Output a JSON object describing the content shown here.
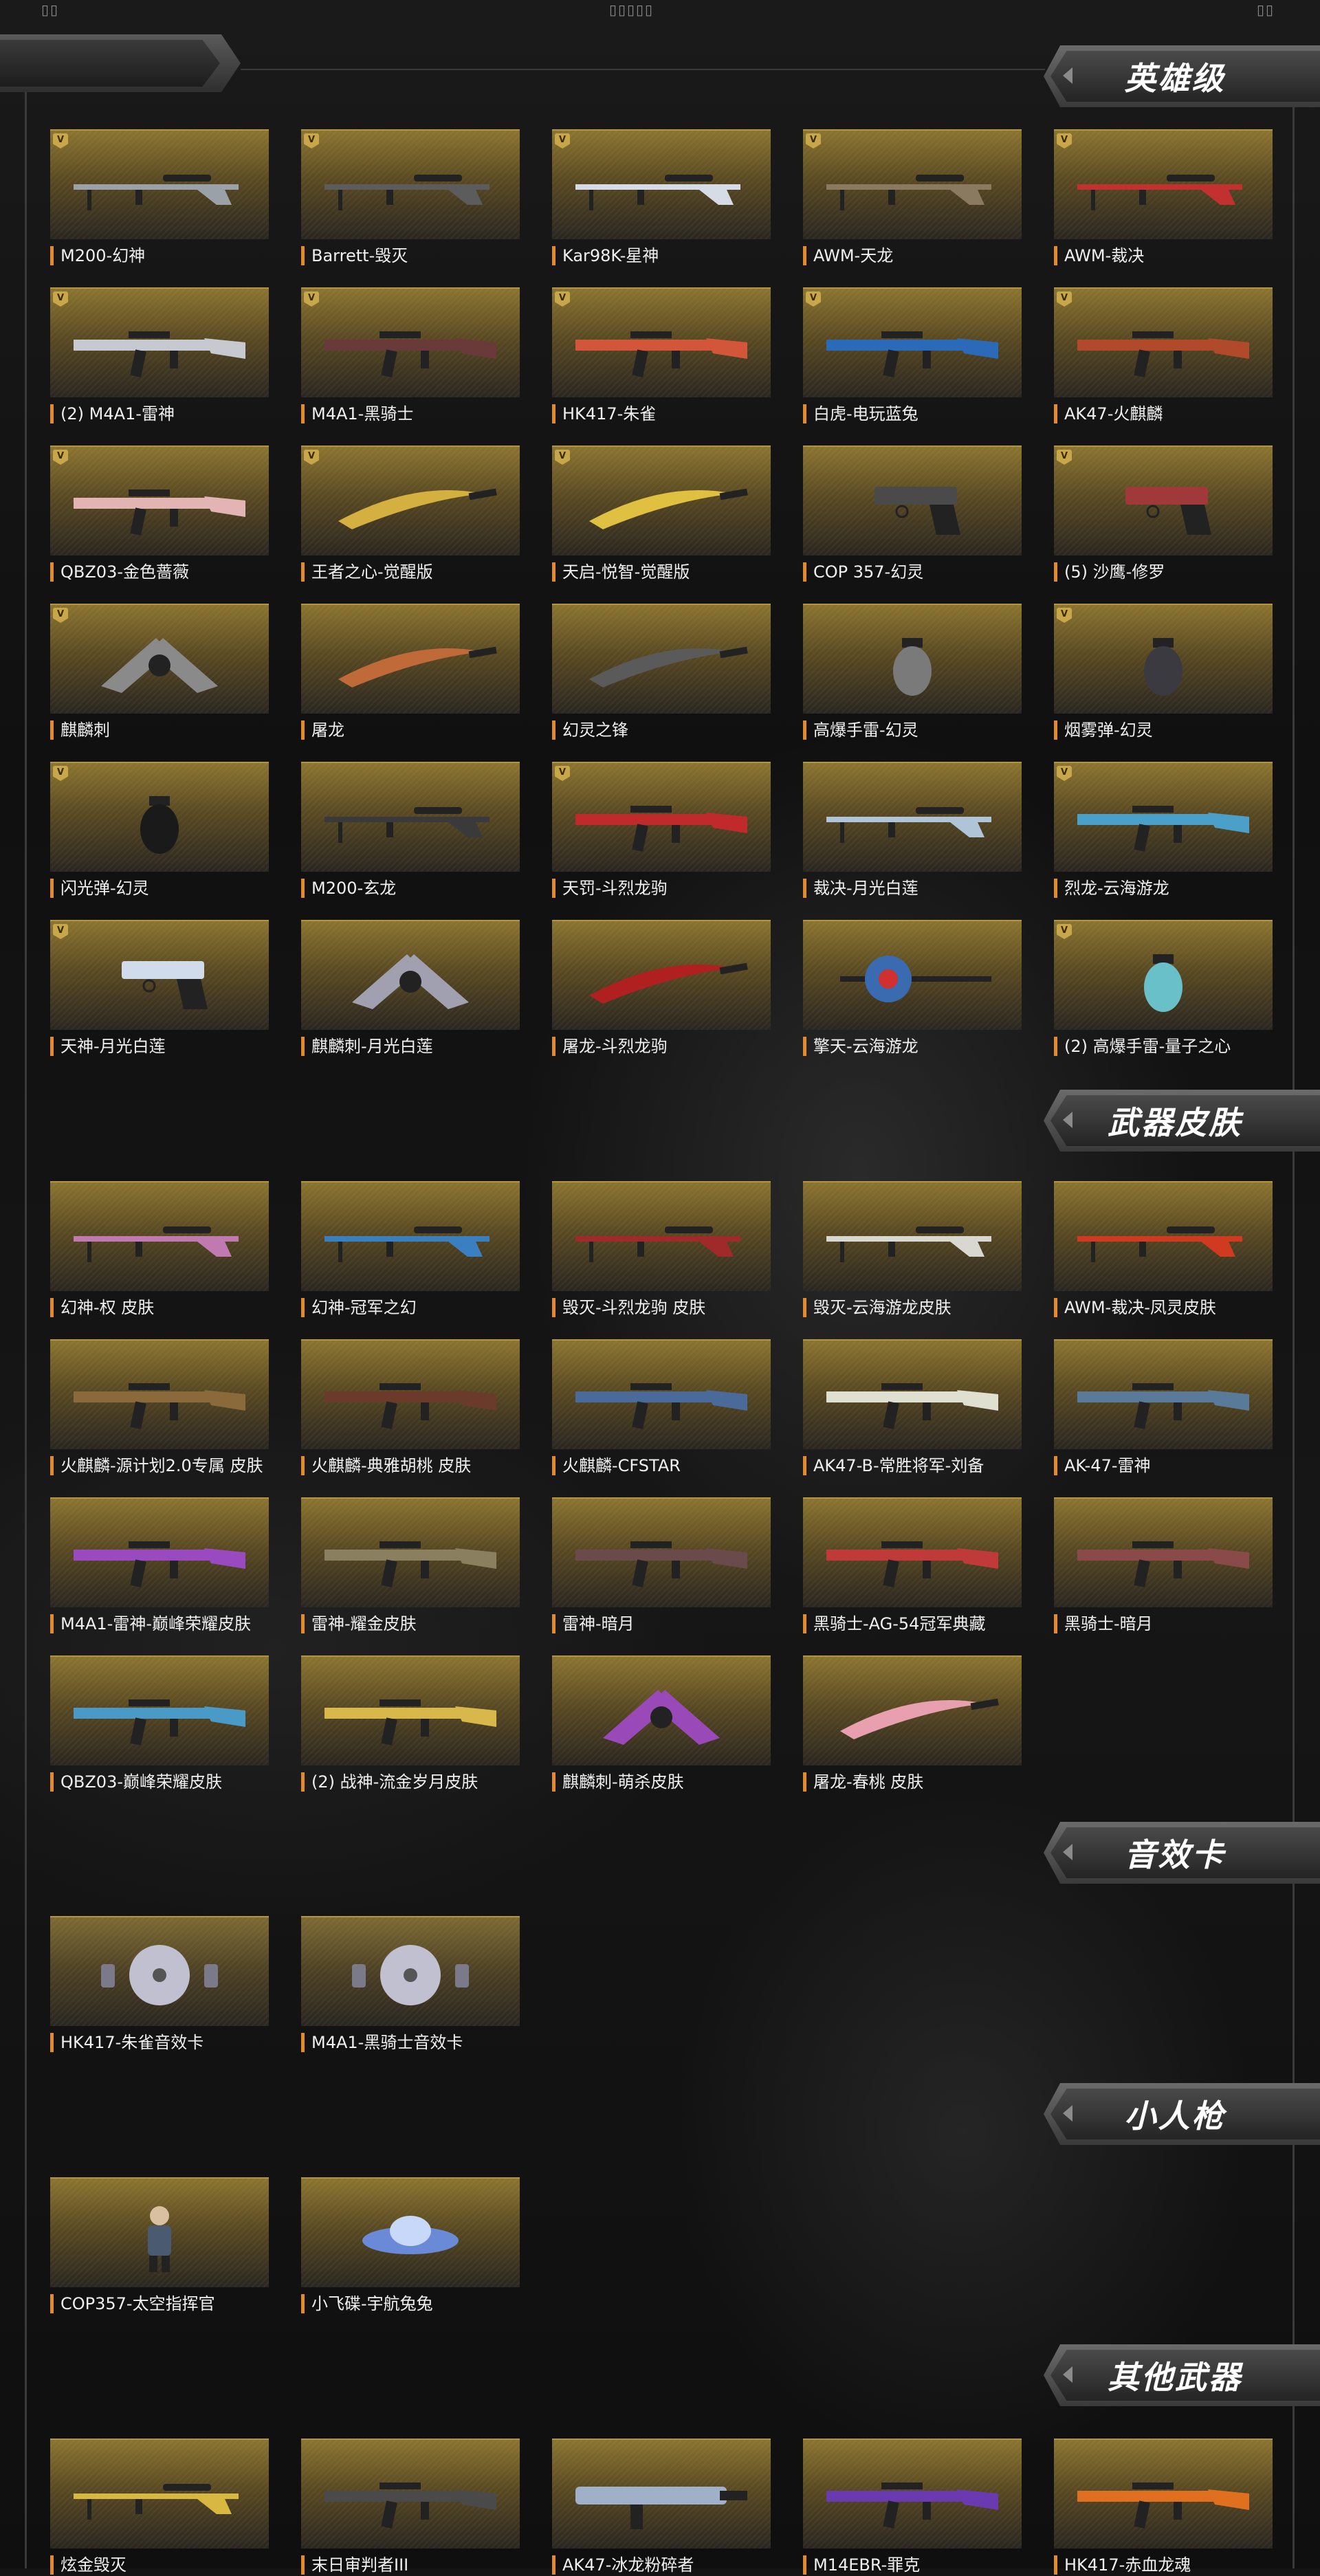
{
  "top_marks": {
    "left": "▯▯",
    "center": "▯▯▯▯▯",
    "right": "▯▯"
  },
  "sections": [
    {
      "title": "英雄级",
      "items": [
        {
          "label": "M200-幻神",
          "icon": "sniper-rifle-icon",
          "color": "#9aa2a8",
          "badge": true
        },
        {
          "label": "Barrett-毁灭",
          "icon": "sniper-rifle-icon",
          "color": "#5c5c5c",
          "badge": true
        },
        {
          "label": "Kar98K-星神",
          "icon": "sniper-rifle-icon",
          "color": "#d6dce6",
          "badge": true
        },
        {
          "label": "AWM-天龙",
          "icon": "sniper-rifle-icon",
          "color": "#8a7a60",
          "badge": true
        },
        {
          "label": "AWM-裁决",
          "icon": "sniper-rifle-icon",
          "color": "#c23030",
          "badge": true
        },
        {
          "label": "(2) M4A1-雷神",
          "icon": "assault-rifle-icon",
          "color": "#c6c9d0",
          "badge": true
        },
        {
          "label": "M4A1-黑骑士",
          "icon": "assault-rifle-icon",
          "color": "#6a3a3a",
          "badge": true
        },
        {
          "label": "HK417-朱雀",
          "icon": "assault-rifle-icon",
          "color": "#d4563a",
          "badge": true
        },
        {
          "label": "白虎-电玩蓝兔",
          "icon": "assault-rifle-icon",
          "color": "#2a6ab8",
          "badge": true
        },
        {
          "label": "AK47-火麒麟",
          "icon": "assault-rifle-icon",
          "color": "#b04a2a",
          "badge": true
        },
        {
          "label": "QBZ03-金色蔷薇",
          "icon": "assault-rifle-icon",
          "color": "#e2b4b4",
          "badge": true
        },
        {
          "label": "王者之心-觉醒版",
          "icon": "melee-blade-icon",
          "color": "#d4b040",
          "badge": true
        },
        {
          "label": "天启-悦智-觉醒版",
          "icon": "melee-blade-icon",
          "color": "#e0c040",
          "badge": true
        },
        {
          "label": "COP 357-幻灵",
          "icon": "pistol-icon",
          "color": "#4a4a4a",
          "badge": false
        },
        {
          "label": "(5) 沙鹰-修罗",
          "icon": "pistol-icon",
          "color": "#a03a3a",
          "badge": true
        },
        {
          "label": "麒麟刺",
          "icon": "melee-claw-icon",
          "color": "#8a8a8a",
          "badge": true
        },
        {
          "label": "屠龙",
          "icon": "melee-blade-icon",
          "color": "#c06a3a",
          "badge": false
        },
        {
          "label": "幻灵之锋",
          "icon": "melee-blade-icon",
          "color": "#5a5a5a",
          "badge": false
        },
        {
          "label": "高爆手雷-幻灵",
          "icon": "grenade-icon",
          "color": "#7a7a7a",
          "badge": false
        },
        {
          "label": "烟雾弹-幻灵",
          "icon": "grenade-icon",
          "color": "#3a3a40",
          "badge": true
        },
        {
          "label": "闪光弹-幻灵",
          "icon": "grenade-icon",
          "color": "#1a1a1a",
          "badge": true
        },
        {
          "label": "M200-玄龙",
          "icon": "sniper-rifle-icon",
          "color": "#3a3a3a",
          "badge": false
        },
        {
          "label": "天罚-斗烈龙驹",
          "icon": "assault-rifle-icon",
          "color": "#c02a2a",
          "badge": true
        },
        {
          "label": "裁决-月光白莲",
          "icon": "sniper-rifle-icon",
          "color": "#b0c4d8",
          "badge": false
        },
        {
          "label": "烈龙-云海游龙",
          "icon": "assault-rifle-icon",
          "color": "#4aa0c8",
          "badge": true
        },
        {
          "label": "天神-月光白莲",
          "icon": "pistol-icon",
          "color": "#d0dcec",
          "badge": true
        },
        {
          "label": "麒麟刺-月光白莲",
          "icon": "melee-claw-icon",
          "color": "#a0a0b0",
          "badge": false
        },
        {
          "label": "屠龙-斗烈龙驹",
          "icon": "melee-blade-icon",
          "color": "#b02020",
          "badge": false
        },
        {
          "label": "擎天-云海游龙",
          "icon": "melee-axe-icon",
          "color": "#3a6ab0",
          "badge": false
        },
        {
          "label": "(2) 高爆手雷-量子之心",
          "icon": "grenade-icon",
          "color": "#6ac0c8",
          "badge": true
        }
      ]
    },
    {
      "title": "武器皮肤",
      "items": [
        {
          "label": "幻神-权 皮肤",
          "icon": "sniper-rifle-icon",
          "color": "#c07ab0"
        },
        {
          "label": "幻神-冠军之幻",
          "icon": "sniper-rifle-icon",
          "color": "#3a80c0"
        },
        {
          "label": "毁灭-斗烈龙驹 皮肤",
          "icon": "sniper-rifle-icon",
          "color": "#a02a2a"
        },
        {
          "label": "毁灭-云海游龙皮肤",
          "icon": "sniper-rifle-icon",
          "color": "#d8d8d0"
        },
        {
          "label": "AWM-裁决-凤灵皮肤",
          "icon": "sniper-rifle-icon",
          "color": "#d03a20"
        },
        {
          "label": "火麒麟-源计划2.0专属 皮肤",
          "icon": "assault-rifle-icon",
          "color": "#8a6a3a"
        },
        {
          "label": "火麒麟-典雅胡桃 皮肤",
          "icon": "assault-rifle-icon",
          "color": "#6a3a2a"
        },
        {
          "label": "火麒麟-CFSTAR",
          "icon": "assault-rifle-icon",
          "color": "#4a6a9a"
        },
        {
          "label": "AK47-B-常胜将军-刘备",
          "icon": "assault-rifle-icon",
          "color": "#e0e0d0"
        },
        {
          "label": "AK-47-雷神",
          "icon": "assault-rifle-icon",
          "color": "#5a7a9a"
        },
        {
          "label": "M4A1-雷神-巅峰荣耀皮肤",
          "icon": "assault-rifle-icon",
          "color": "#9a4ac0"
        },
        {
          "label": "雷神-耀金皮肤",
          "icon": "assault-rifle-icon",
          "color": "#8a8060"
        },
        {
          "label": "雷神-暗月",
          "icon": "assault-rifle-icon",
          "color": "#6a4a4a"
        },
        {
          "label": "黑骑士-AG-54冠军典藏",
          "icon": "assault-rifle-icon",
          "color": "#c03a3a"
        },
        {
          "label": "黑骑士-暗月",
          "icon": "assault-rifle-icon",
          "color": "#8a4a4a"
        },
        {
          "label": "QBZ03-巅峰荣耀皮肤",
          "icon": "assault-rifle-icon",
          "color": "#4a9ac8"
        },
        {
          "label": "(2) 战神-流金岁月皮肤",
          "icon": "assault-rifle-icon",
          "color": "#d8b84a"
        },
        {
          "label": "麒麟刺-萌杀皮肤",
          "icon": "melee-claw-icon",
          "color": "#9a4ab8"
        },
        {
          "label": "屠龙-春桃 皮肤",
          "icon": "melee-blade-icon",
          "color": "#e8a0b0"
        }
      ]
    },
    {
      "title": "音效卡",
      "items": [
        {
          "label": "HK417-朱雀音效卡",
          "icon": "sound-card-disc-icon",
          "color": "#c0c0d0"
        },
        {
          "label": "M4A1-黑骑士音效卡",
          "icon": "sound-card-disc-icon",
          "color": "#c0c0d0"
        }
      ]
    },
    {
      "title": "小人枪",
      "items": [
        {
          "label": "COP357-太空指挥官",
          "icon": "mini-figure-icon",
          "color": "#4a5a70"
        },
        {
          "label": "小飞碟-宇航兔兔",
          "icon": "ufo-icon",
          "color": "#6a8ad8"
        }
      ]
    },
    {
      "title": "其他武器",
      "items": [
        {
          "label": "炫金毁灭",
          "icon": "sniper-rifle-icon",
          "color": "#d8b840"
        },
        {
          "label": "末日审判者III",
          "icon": "assault-rifle-icon",
          "color": "#4a4a4a"
        },
        {
          "label": "AK47-冰龙粉碎者",
          "icon": "heavy-gun-icon",
          "color": "#a0b0c8"
        },
        {
          "label": "M14EBR-罪克",
          "icon": "assault-rifle-icon",
          "color": "#6a3ab0"
        },
        {
          "label": "HK417-赤血龙魂",
          "icon": "assault-rifle-icon",
          "color": "#e07020"
        }
      ]
    }
  ]
}
